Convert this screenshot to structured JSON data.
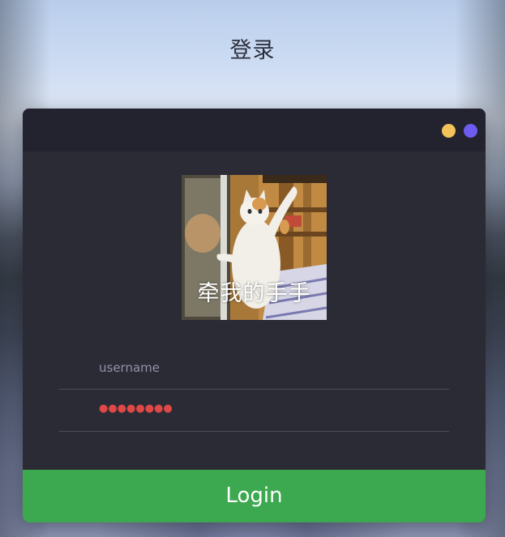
{
  "page": {
    "title": "登录"
  },
  "window_controls": {
    "dots": [
      {
        "name": "yellow",
        "color": "#f3c35a"
      },
      {
        "name": "purple",
        "color": "#6c5cf0"
      }
    ]
  },
  "avatar": {
    "caption": "牵我的手手"
  },
  "form": {
    "username_placeholder": "username",
    "username_value": "",
    "password_mask": "●●●●●●●●",
    "login_label": "Login"
  },
  "colors": {
    "card": "#2b2b36",
    "header": "#232330",
    "button": "#3ca84f",
    "password_dots": "#e04846"
  }
}
